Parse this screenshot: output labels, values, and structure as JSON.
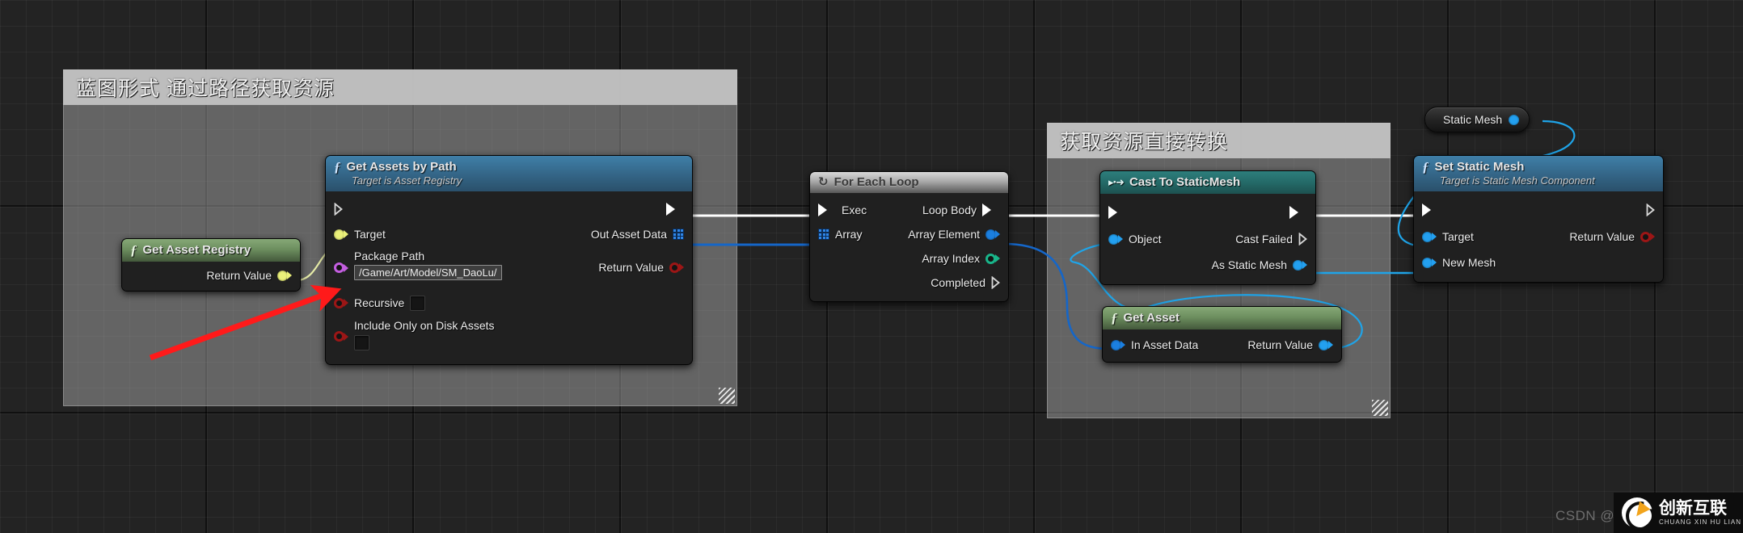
{
  "canvas": {
    "background_color": "#232323",
    "grid_line_color": "#2e2e2e"
  },
  "comments": [
    {
      "id": "comment-blueprint-path",
      "title": "蓝图形式 通过路径获取资源",
      "header_color": "#c4c4c4",
      "body_color": "#bebebe"
    },
    {
      "id": "comment-direct-cast",
      "title": "获取资源直接转换",
      "header_color": "#c4c4c4",
      "body_color": "#bebebe"
    }
  ],
  "nodes": {
    "get_asset_registry": {
      "title": "Get Asset Registry",
      "icon": "function-f-icon",
      "header_style": "pure",
      "outputs": [
        {
          "label": "Return Value",
          "pin": "object-pin",
          "color": "#eaf07a"
        }
      ]
    },
    "get_assets_by_path": {
      "title": "Get Assets by Path",
      "subtitle": "Target is Asset Registry",
      "icon": "function-f-icon",
      "header_style": "function",
      "exec_in": "",
      "exec_out": "",
      "inputs": [
        {
          "label": "Target",
          "pin": "object-pin",
          "color": "#eaf07a"
        },
        {
          "label": "Package Path",
          "pin": "name-pin",
          "color": "#c45ee0",
          "value": "/Game/Art/Model/SM_DaoLu/",
          "widget": "text-field"
        },
        {
          "label": "Recursive",
          "pin": "bool-pin",
          "color": "#9c1616",
          "widget": "checkbox",
          "checked": false
        },
        {
          "label": "Include Only on Disk Assets",
          "pin": "bool-pin",
          "color": "#9c1616",
          "widget": "checkbox",
          "checked": false
        }
      ],
      "outputs": [
        {
          "label": "Out Asset Data",
          "pin": "array-pin",
          "color": "#2f86e8"
        },
        {
          "label": "Return Value",
          "pin": "bool-pin",
          "color": "#9c1616"
        }
      ]
    },
    "for_each_loop": {
      "title": "For Each Loop",
      "icon": "loop-icon",
      "header_style": "flow",
      "inputs": [
        {
          "label": "Exec",
          "pin": "exec-pin",
          "color": "#ffffff"
        },
        {
          "label": "Array",
          "pin": "array-pin",
          "color": "#2f86e8"
        }
      ],
      "outputs": [
        {
          "label": "Loop Body",
          "pin": "exec-pin",
          "color": "#ffffff"
        },
        {
          "label": "Array Element",
          "pin": "struct-pin",
          "color": "#1b7fe0"
        },
        {
          "label": "Array Index",
          "pin": "int-pin",
          "color": "#19b58a"
        },
        {
          "label": "Completed",
          "pin": "exec-pin-hollow",
          "color": "#ffffff"
        }
      ]
    },
    "cast_to_static_mesh": {
      "title": "Cast To StaticMesh",
      "icon": "cast-icon",
      "header_style": "cast",
      "inputs": [
        {
          "label": "",
          "pin": "exec-pin",
          "color": "#ffffff"
        },
        {
          "label": "Object",
          "pin": "object-pin",
          "color": "#23a0f0"
        }
      ],
      "outputs": [
        {
          "label": "",
          "pin": "exec-pin",
          "color": "#ffffff"
        },
        {
          "label": "Cast Failed",
          "pin": "exec-pin-hollow",
          "color": "#ffffff"
        },
        {
          "label": "As Static Mesh",
          "pin": "object-pin",
          "color": "#23a0f0"
        }
      ]
    },
    "get_asset": {
      "title": "Get Asset",
      "icon": "function-f-icon",
      "header_style": "pure",
      "inputs": [
        {
          "label": "In Asset Data",
          "pin": "object-pin",
          "color": "#1b7fe0"
        }
      ],
      "outputs": [
        {
          "label": "Return Value",
          "pin": "object-pin",
          "color": "#23a0f0"
        }
      ]
    },
    "static_mesh_var": {
      "title": "Static Mesh",
      "pin_color": "#23a0f0"
    },
    "set_static_mesh": {
      "title": "Set Static Mesh",
      "subtitle": "Target is Static Mesh Component",
      "icon": "function-f-icon",
      "header_style": "function",
      "inputs": [
        {
          "label": "",
          "pin": "exec-pin",
          "color": "#ffffff"
        },
        {
          "label": "Target",
          "pin": "object-pin",
          "color": "#23a0f0"
        },
        {
          "label": "New Mesh",
          "pin": "object-pin",
          "color": "#23a0f0"
        }
      ],
      "outputs": [
        {
          "label": "",
          "pin": "exec-pin-hollow",
          "color": "#ffffff"
        },
        {
          "label": "Return Value",
          "pin": "bool-pin",
          "color": "#9c1616"
        }
      ]
    }
  },
  "annotations": {
    "red_arrow": {
      "color": "#ff1a1a",
      "points_to": "package-path-pin"
    }
  },
  "watermark": {
    "text": "CSDN @t",
    "logo_name": "创新互联",
    "logo_pinyin": "CHUANG XIN HU LIAN"
  }
}
